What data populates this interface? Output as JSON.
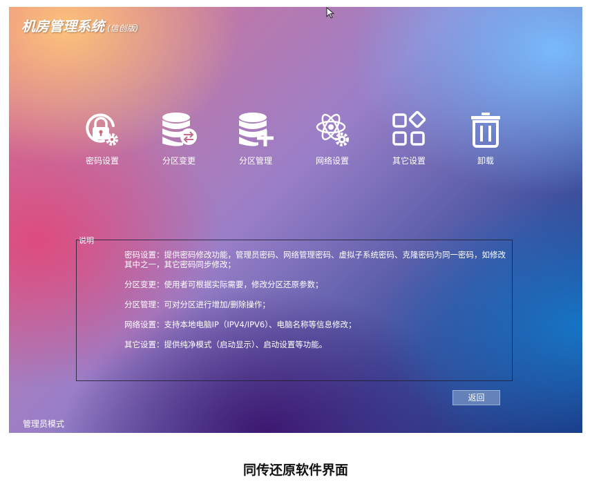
{
  "window": {
    "title": "机房管理系统",
    "title_suffix": "(信创版)"
  },
  "menu": [
    {
      "label": "密码设置",
      "icon": "lock-gear-icon"
    },
    {
      "label": "分区变更",
      "icon": "database-swap-icon"
    },
    {
      "label": "分区管理",
      "icon": "database-add-icon"
    },
    {
      "label": "网络设置",
      "icon": "network-gear-icon"
    },
    {
      "label": "其它设置",
      "icon": "grid-diamond-icon"
    },
    {
      "label": "卸载",
      "icon": "trash-icon"
    }
  ],
  "description": {
    "legend": "说明",
    "lines": [
      "密码设置：提供密码修改功能，管理员密码、网络管理密码、虚拟子系统密码、克隆密码为同一密码，如修改其中之一，其它密码同步修改；",
      "分区变更：使用者可根据实际需要，修改分区还原参数；",
      "分区管理：可对分区进行增加/删除操作；",
      "网络设置：支持本地电脑IP（IPV4/IPV6）、电脑名称等信息修改；",
      "其它设置：提供纯净模式（启动显示）、启动设置等功能。"
    ]
  },
  "buttons": {
    "back_label": "返回"
  },
  "status": {
    "mode_label": "管理员模式"
  },
  "caption": "同传还原软件界面",
  "colors": {
    "accent": "#ffffff",
    "button_bg": "#6e8cbe"
  }
}
